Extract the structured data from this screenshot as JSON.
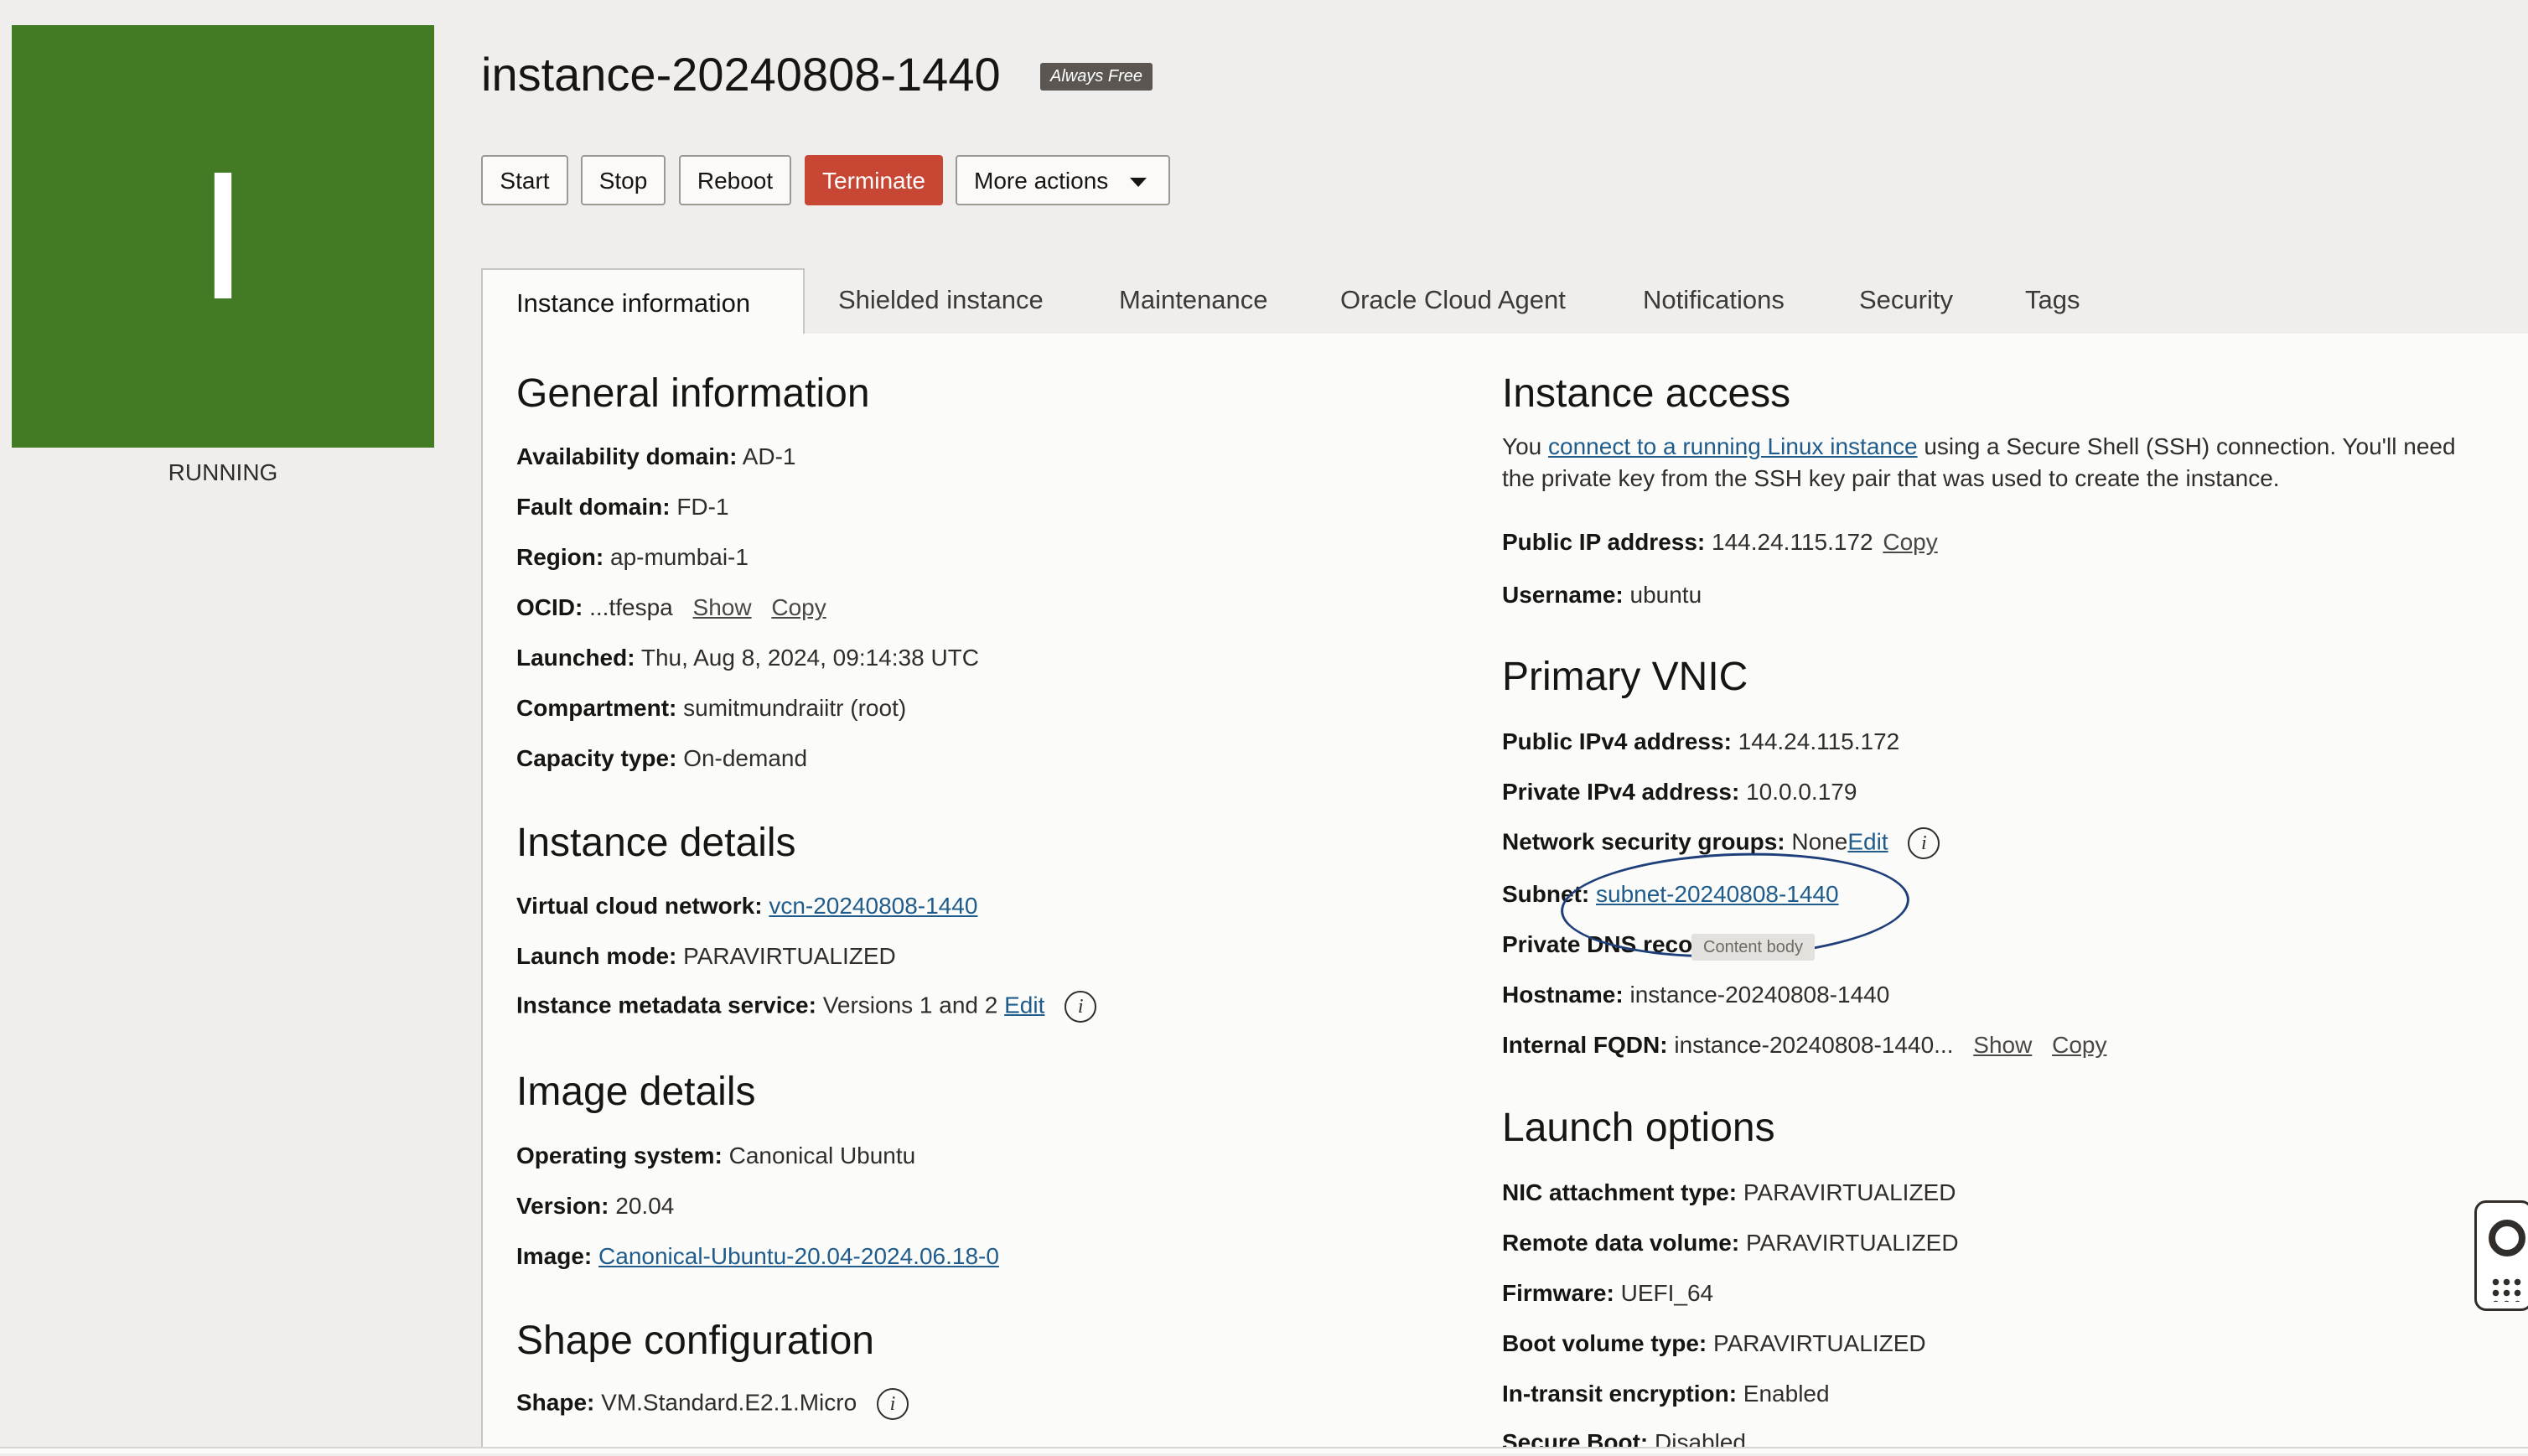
{
  "instance": {
    "initial": "I",
    "status": "RUNNING",
    "name": "instance-20240808-1440",
    "badge": "Always Free"
  },
  "actions": {
    "start": "Start",
    "stop": "Stop",
    "reboot": "Reboot",
    "terminate": "Terminate",
    "more": "More actions"
  },
  "tabs": [
    {
      "label": "Instance information",
      "active": true
    },
    {
      "label": "Shielded instance"
    },
    {
      "label": "Maintenance"
    },
    {
      "label": "Oracle Cloud Agent"
    },
    {
      "label": "Notifications"
    },
    {
      "label": "Security"
    },
    {
      "label": "Tags"
    }
  ],
  "general": {
    "heading": "General information",
    "availability_label": "Availability domain:",
    "availability_value": "AD-1",
    "fault_label": "Fault domain:",
    "fault_value": "FD-1",
    "region_label": "Region:",
    "region_value": "ap-mumbai-1",
    "ocid_label": "OCID:",
    "ocid_value": "...tfespa",
    "ocid_show": "Show",
    "ocid_copy": "Copy",
    "launched_label": "Launched:",
    "launched_value": "Thu, Aug 8, 2024, 09:14:38 UTC",
    "compartment_label": "Compartment:",
    "compartment_value": "sumitmundraiitr (root)",
    "capacity_label": "Capacity type:",
    "capacity_value": "On-demand"
  },
  "details": {
    "heading": "Instance details",
    "vcn_label": "Virtual cloud network:",
    "vcn_value": "vcn-20240808-1440",
    "launch_mode_label": "Launch mode:",
    "launch_mode_value": "PARAVIRTUALIZED",
    "metadata_label": "Instance metadata service:",
    "metadata_value": "Versions 1 and 2",
    "metadata_edit": "Edit"
  },
  "image": {
    "heading": "Image details",
    "os_label": "Operating system:",
    "os_value": "Canonical Ubuntu",
    "version_label": "Version:",
    "version_value": "20.04",
    "image_label": "Image:",
    "image_value": "Canonical-Ubuntu-20.04-2024.06.18-0"
  },
  "shape": {
    "heading": "Shape configuration",
    "shape_label": "Shape:",
    "shape_value": "VM.Standard.E2.1.Micro"
  },
  "access": {
    "heading": "Instance access",
    "text_prefix": "You ",
    "text_link": "connect to a running Linux instance",
    "text_suffix": " using a Secure Shell (SSH) connection. You'll need the private key from the SSH key pair that was used to create the instance.",
    "public_ip_label": "Public IP address:",
    "public_ip_value": "144.24.115.172",
    "public_ip_copy": "Copy",
    "username_label": "Username:",
    "username_value": "ubuntu"
  },
  "vnic": {
    "heading": "Primary VNIC",
    "ipv4_label": "Public IPv4 address:",
    "ipv4_value": "144.24.115.172",
    "private_label": "Private IPv4 address:",
    "private_value": "10.0.0.179",
    "nsg_label": "Network security groups:",
    "nsg_value": "None",
    "nsg_edit": "Edit",
    "subnet_label": "Subnet:",
    "subnet_value": "subnet-20240808-1440",
    "dns_label": "Private DNS record",
    "tooltip": "Content body",
    "hostname_label": "Hostname:",
    "hostname_value": "instance-20240808-1440",
    "fqdn_label": "Internal FQDN:",
    "fqdn_value": "instance-20240808-1440...",
    "fqdn_show": "Show",
    "fqdn_copy": "Copy"
  },
  "launch": {
    "heading": "Launch options",
    "nic_label": "NIC attachment type:",
    "nic_value": "PARAVIRTUALIZED",
    "remote_label": "Remote data volume:",
    "remote_value": "PARAVIRTUALIZED",
    "firmware_label": "Firmware:",
    "firmware_value": "UEFI_64",
    "boot_label": "Boot volume type:",
    "boot_value": "PARAVIRTUALIZED",
    "transit_label": "In-transit encryption:",
    "transit_value": "Enabled",
    "secure_label": "Secure Boot:",
    "secure_value": "Disabled"
  },
  "icons": {
    "info": "i",
    "help": "lifebuoy-icon",
    "apps": "grid-icon"
  },
  "colors": {
    "running": "#437a24",
    "terminate": "#c74634",
    "link": "#1f5c8c"
  }
}
